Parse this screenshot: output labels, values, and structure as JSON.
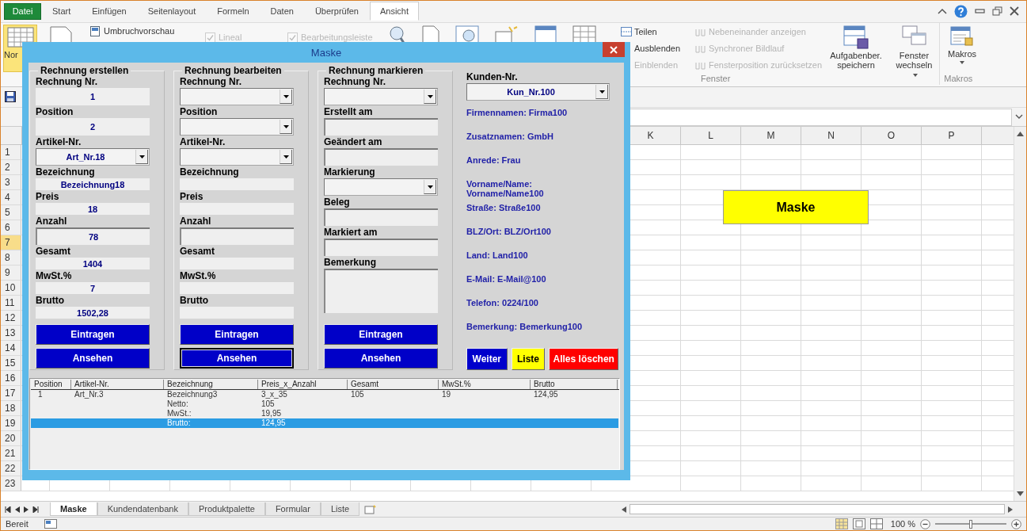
{
  "file_tab": "Datei",
  "tabs": [
    {
      "label": "Start",
      "selected": false
    },
    {
      "label": "Einfügen",
      "selected": false
    },
    {
      "label": "Seitenlayout",
      "selected": false
    },
    {
      "label": "Formeln",
      "selected": false
    },
    {
      "label": "Daten",
      "selected": false
    },
    {
      "label": "Überprüfen",
      "selected": false
    },
    {
      "label": "Ansicht",
      "selected": true
    }
  ],
  "ribbon": {
    "views": [
      {
        "label": "Nor",
        "selected": true
      }
    ],
    "view_links": [
      "Umbruchvorschau"
    ],
    "show_options": [
      {
        "label": "Lineal",
        "checked": true,
        "disabled": true
      },
      {
        "label": "Bearbeitungsleiste",
        "checked": true,
        "disabled": true
      }
    ],
    "window_commands": [
      {
        "label": "Teilen",
        "disabled": false
      },
      {
        "label": "Ausblenden",
        "disabled": false
      },
      {
        "label": "Einblenden",
        "disabled": true
      }
    ],
    "compare_commands": [
      {
        "label": "Nebeneinander anzeigen",
        "disabled": true
      },
      {
        "label": "Synchroner Bildlauf",
        "disabled": true
      },
      {
        "label": "Fensterposition zurücksetzen",
        "disabled": true
      }
    ],
    "window_buttons": [
      {
        "label": "Aufgabenber. speichern",
        "dropdown": false
      },
      {
        "label": "Fenster wechseln",
        "dropdown": true
      }
    ],
    "window_group": "Fenster",
    "macro_button": {
      "label": "Makros",
      "dropdown": true
    },
    "macro_group": "Makros"
  },
  "sheet": {
    "columns": [
      "K",
      "L",
      "M",
      "N",
      "O",
      "P"
    ],
    "rows": [
      {
        "label": "1",
        "selected": false
      },
      {
        "label": "2",
        "selected": false
      },
      {
        "label": "3",
        "selected": false
      },
      {
        "label": "4",
        "selected": false
      },
      {
        "label": "5",
        "selected": false
      },
      {
        "label": "6",
        "selected": false
      },
      {
        "label": "7",
        "selected": true
      },
      {
        "label": "8",
        "selected": false
      },
      {
        "label": "9",
        "selected": false
      },
      {
        "label": "10",
        "selected": false
      },
      {
        "label": "11",
        "selected": false
      },
      {
        "label": "12",
        "selected": false
      },
      {
        "label": "13",
        "selected": false
      },
      {
        "label": "14",
        "selected": false
      },
      {
        "label": "15",
        "selected": false
      },
      {
        "label": "16",
        "selected": false
      },
      {
        "label": "17",
        "selected": false
      },
      {
        "label": "18",
        "selected": false
      },
      {
        "label": "19",
        "selected": false
      },
      {
        "label": "20",
        "selected": false
      },
      {
        "label": "21",
        "selected": false
      },
      {
        "label": "22",
        "selected": false
      },
      {
        "label": "23",
        "selected": false
      }
    ],
    "shape_button": "Maske"
  },
  "sheet_tabs": [
    {
      "label": "Maske",
      "selected": true
    },
    {
      "label": "Kundendatenbank",
      "selected": false
    },
    {
      "label": "Produktpalette",
      "selected": false
    },
    {
      "label": "Formular",
      "selected": false
    },
    {
      "label": "Liste",
      "selected": false
    }
  ],
  "status": {
    "text": "Bereit",
    "zoom": "100 %",
    "zoom_slider": {
      "level": 0.5
    }
  },
  "dialog": {
    "title": "Maske",
    "sections": [
      {
        "title": "Rechnung erstellen",
        "fields": [
          {
            "label": "Rechnung Nr.",
            "kind": "plain",
            "value": "1"
          },
          {
            "label": "Position",
            "kind": "plain",
            "value": "2"
          },
          {
            "label": "Artikel-Nr.",
            "kind": "combo",
            "value": "Art_Nr.18"
          },
          {
            "label": "Bezeichnung",
            "kind": "thin",
            "value": "Bezeichnung18"
          },
          {
            "label": "Preis",
            "kind": "thin",
            "value": "18"
          },
          {
            "label": "Anzahl",
            "kind": "sunken",
            "value": "78"
          },
          {
            "label": "Gesamt",
            "kind": "thin",
            "value": "1404"
          },
          {
            "label": "MwSt.%",
            "kind": "thin",
            "value": "7"
          },
          {
            "label": "Brutto",
            "kind": "thin",
            "value": "1502,28"
          }
        ],
        "buttons": [
          {
            "label": "Eintragen",
            "focused": false
          },
          {
            "label": "Ansehen",
            "focused": false
          }
        ]
      },
      {
        "title": "Rechnung bearbeiten",
        "fields": [
          {
            "label": "Rechnung Nr.",
            "kind": "combo"
          },
          {
            "label": "Position",
            "kind": "combo"
          },
          {
            "label": "Artikel-Nr.",
            "kind": "combo"
          },
          {
            "label": "Bezeichnung",
            "kind": "thin"
          },
          {
            "label": "Preis",
            "kind": "thin"
          },
          {
            "label": "Anzahl",
            "kind": "sunken"
          },
          {
            "label": "Gesamt",
            "kind": "thin"
          },
          {
            "label": "MwSt.%",
            "kind": "thin"
          },
          {
            "label": "Brutto",
            "kind": "thin"
          }
        ],
        "buttons": [
          {
            "label": "Eintragen",
            "focused": false
          },
          {
            "label": "Ansehen",
            "focused": true
          }
        ]
      },
      {
        "title": "Rechnung markieren",
        "fields": [
          {
            "label": "Rechnung Nr.",
            "kind": "combo"
          },
          {
            "label": "Erstellt am",
            "kind": "sunken"
          },
          {
            "label": "Geändert am",
            "kind": "sunken"
          },
          {
            "label": "Markierung",
            "kind": "combo"
          },
          {
            "label": "Beleg",
            "kind": "sunken"
          },
          {
            "label": "Markiert am",
            "kind": "sunken"
          },
          {
            "label": "Bemerkung",
            "kind": "memo"
          }
        ],
        "buttons": [
          {
            "label": "Eintragen",
            "focused": false
          },
          {
            "label": "Ansehen",
            "focused": false
          }
        ]
      }
    ],
    "customer": {
      "label": "Kunden-Nr.",
      "value": "Kun_Nr.100",
      "details": [
        "Firmennamen: Firma100",
        "Zusatznamen: GmbH",
        "Anrede: Frau",
        "Vorname/Name: Vorname/Name100",
        "Straße: Straße100",
        "BLZ/Ort: BLZ/Ort100",
        "Land: Land100",
        "E-Mail: E-Mail@100",
        "Telefon: 0224/100",
        "Bemerkung: Bemerkung100"
      ],
      "buttons": [
        {
          "label": "Weiter",
          "color": "#0000cc"
        },
        {
          "label": "Liste",
          "color": "#ffff00"
        },
        {
          "label": "Alles löschen",
          "color": "#ff0000"
        }
      ]
    },
    "list": {
      "columns": [
        "Position",
        "Artikel-Nr.",
        "Bezeichnung",
        "Preis_x_Anzahl",
        "Gesamt",
        "MwSt.%",
        "Brutto"
      ],
      "rows": [
        {
          "cells": [
            "1",
            "Art_Nr.3",
            "Bezeichnung3",
            "3_x_35",
            "105",
            "19",
            "124,95"
          ],
          "selected": false
        },
        {
          "cells": [
            null,
            null,
            "Netto:",
            "105",
            null,
            null,
            null
          ],
          "selected": false
        },
        {
          "cells": [
            null,
            null,
            "MwSt.:",
            "19,95",
            null,
            null,
            null
          ],
          "selected": false
        },
        {
          "cells": [
            null,
            null,
            "Brutto:",
            "124,95",
            null,
            null,
            null
          ],
          "selected": true
        }
      ]
    }
  }
}
